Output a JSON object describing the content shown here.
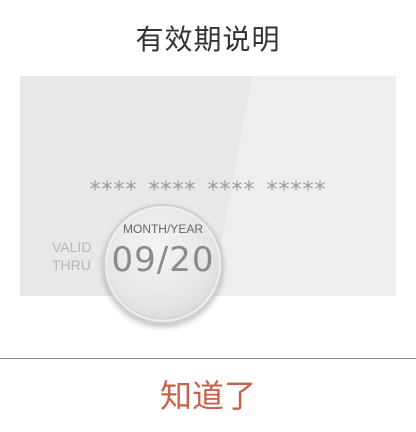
{
  "dialog": {
    "title": "有效期说明",
    "confirm_label": "知道了"
  },
  "card": {
    "number_mask": "**** **** **** *****",
    "valid_label_line1": "VALID",
    "valid_label_line2": "THRU",
    "expiry_caption": "MONTH/YEAR",
    "expiry_value": "09/20"
  },
  "colors": {
    "confirm_text": "#c8604a",
    "card_background": "#e6e8ea"
  }
}
